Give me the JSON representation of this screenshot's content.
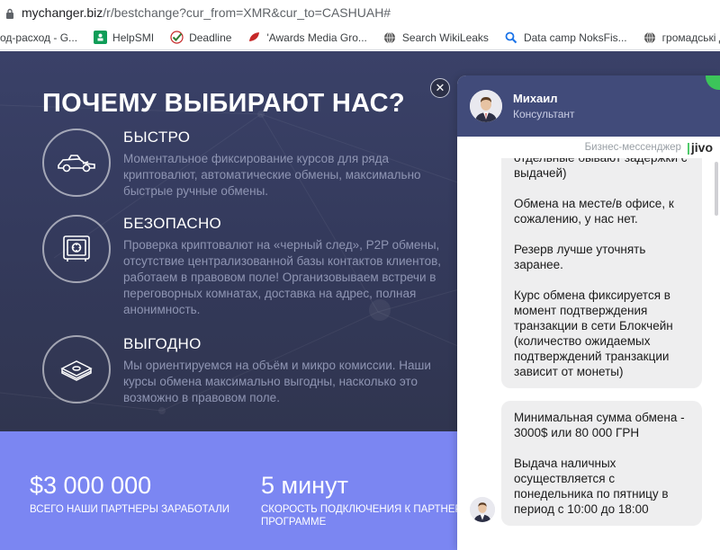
{
  "browser": {
    "url_host": "mychanger.biz",
    "url_path": "/r/bestchange?cur_from=XMR&cur_to=CASHUAH#"
  },
  "bookmarks": [
    {
      "label": "од-расход - G...",
      "icon": "sheet-icon",
      "color": "#0f9d58"
    },
    {
      "label": "HelpSMI",
      "icon": "form-icon",
      "color": "#0f9d58"
    },
    {
      "label": "Deadline",
      "icon": "check-icon",
      "color": "#2e7d32"
    },
    {
      "label": "'Awards Media Gro...",
      "icon": "leaf-icon",
      "color": "#c62828"
    },
    {
      "label": "Search WikiLeaks",
      "icon": "globe-icon",
      "color": "#555555"
    },
    {
      "label": "Data camp NoksFis...",
      "icon": "magnifier-icon",
      "color": "#1a73e8"
    },
    {
      "label": "громадські діячі ба...",
      "icon": "globe-icon",
      "color": "#555555"
    },
    {
      "label": "",
      "icon": "orange-logo-icon",
      "color": "#f57c00"
    }
  ],
  "hero": {
    "title": "ПОЧЕМУ ВЫБИРАЮТ НАС?",
    "features": [
      {
        "icon": "race-car-icon",
        "title": "БЫСТРО",
        "desc": "Моментальное фиксирование курсов для ряда криптовалют, автоматические обмены, максимально быстрые ручные обмены."
      },
      {
        "icon": "safe-icon",
        "title": "БЕЗОПАСНО",
        "desc": "Проверка криптовалют на «черный след», P2P обмены, отсутствие централизованной базы контактов клиентов, работаем в правовом поле! Организовываем встречи в переговорных комнатах, доставка на адрес, полная анонимность."
      },
      {
        "icon": "money-stack-icon",
        "title": "ВЫГОДНО",
        "desc": "Мы ориентируемся на объём и микро комиссии. Наши курсы обмена максимально выгодны, насколько это возможно в правовом поле."
      }
    ]
  },
  "stats": [
    {
      "value": "$3 000 000",
      "label": "ВСЕГО НАШИ ПАРТНЕРЫ ЗАРАБОТАЛИ"
    },
    {
      "value": "5 минут",
      "label_line1": "СКОРОСТЬ ПОДКЛЮЧЕНИЯ К ПАРТНЕР",
      "label_line2": "ПРОГРАММЕ"
    }
  ],
  "chat": {
    "agent_name": "Михаил",
    "agent_role": "Консультант",
    "brand_text": "Бизнес-мессенджер",
    "brand_logo": "jivo",
    "messages": [
      {
        "paragraphs": [
          "отдельные бывают задержки с выдачей)",
          "Обмена на месте/в офисе, к сожалению, у нас нет.",
          "Резерв лучше уточнять заранее.",
          "Курс обмена фиксируется в момент подтверждения транзакции в сети Блокчейн (количество ожидаемых подтверждений транзакции зависит от монеты)"
        ]
      },
      {
        "paragraphs": [
          "Минимальная сумма обмена - 3000$ или 80 000 ГРН",
          "Выдача наличных осуществляется с понедельника по пятницу в период с 10:00 до 18:00"
        ]
      }
    ]
  },
  "colors": {
    "hero_bg": "#363c60",
    "stats_bg": "#7b86f2",
    "chat_header": "#414b7a",
    "bubble_bg": "#eeeeef",
    "online": "#3cc45a"
  }
}
